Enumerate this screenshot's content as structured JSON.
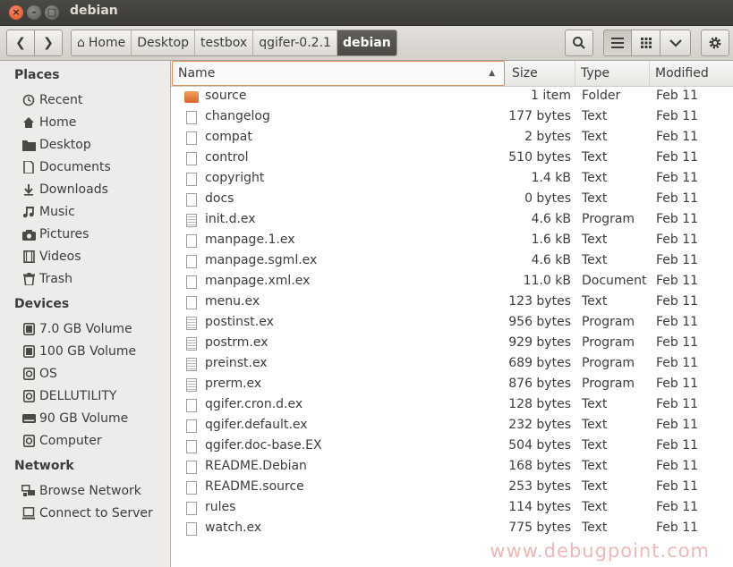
{
  "window": {
    "title": "debian"
  },
  "toolbar": {
    "breadcrumbs": [
      "Home",
      "Desktop",
      "testbox",
      "qgifer-0.2.1",
      "debian"
    ]
  },
  "sidebar": {
    "places_heading": "Places",
    "places": [
      {
        "label": "Recent",
        "icon": "clock-icon"
      },
      {
        "label": "Home",
        "icon": "home-icon"
      },
      {
        "label": "Desktop",
        "icon": "folder-icon"
      },
      {
        "label": "Documents",
        "icon": "document-icon"
      },
      {
        "label": "Downloads",
        "icon": "download-icon"
      },
      {
        "label": "Music",
        "icon": "music-icon"
      },
      {
        "label": "Pictures",
        "icon": "camera-icon"
      },
      {
        "label": "Videos",
        "icon": "film-icon"
      },
      {
        "label": "Trash",
        "icon": "trash-icon"
      }
    ],
    "devices_heading": "Devices",
    "devices": [
      {
        "label": "7.0 GB Volume",
        "icon": "drive-icon"
      },
      {
        "label": "100 GB Volume",
        "icon": "drive-icon"
      },
      {
        "label": "OS",
        "icon": "drive-icon"
      },
      {
        "label": "DELLUTILITY",
        "icon": "drive-icon"
      },
      {
        "label": "90 GB Volume",
        "icon": "drive-icon"
      },
      {
        "label": "Computer",
        "icon": "computer-icon"
      }
    ],
    "network_heading": "Network",
    "network": [
      {
        "label": "Browse Network",
        "icon": "network-icon"
      },
      {
        "label": "Connect to Server",
        "icon": "server-icon"
      }
    ]
  },
  "columns": {
    "name": "Name",
    "size": "Size",
    "type": "Type",
    "modified": "Modified"
  },
  "files": [
    {
      "name": "source",
      "size": "1 item",
      "type": "Folder",
      "modified": "Feb 11",
      "kind": "folder"
    },
    {
      "name": "changelog",
      "size": "177 bytes",
      "type": "Text",
      "modified": "Feb 11",
      "kind": "text"
    },
    {
      "name": "compat",
      "size": "2 bytes",
      "type": "Text",
      "modified": "Feb 11",
      "kind": "text"
    },
    {
      "name": "control",
      "size": "510 bytes",
      "type": "Text",
      "modified": "Feb 11",
      "kind": "text"
    },
    {
      "name": "copyright",
      "size": "1.4 kB",
      "type": "Text",
      "modified": "Feb 11",
      "kind": "text"
    },
    {
      "name": "docs",
      "size": "0 bytes",
      "type": "Text",
      "modified": "Feb 11",
      "kind": "text"
    },
    {
      "name": "init.d.ex",
      "size": "4.6 kB",
      "type": "Program",
      "modified": "Feb 11",
      "kind": "program"
    },
    {
      "name": "manpage.1.ex",
      "size": "1.6 kB",
      "type": "Text",
      "modified": "Feb 11",
      "kind": "text"
    },
    {
      "name": "manpage.sgml.ex",
      "size": "4.6 kB",
      "type": "Text",
      "modified": "Feb 11",
      "kind": "text"
    },
    {
      "name": "manpage.xml.ex",
      "size": "11.0 kB",
      "type": "Document",
      "modified": "Feb 11",
      "kind": "text"
    },
    {
      "name": "menu.ex",
      "size": "123 bytes",
      "type": "Text",
      "modified": "Feb 11",
      "kind": "text"
    },
    {
      "name": "postinst.ex",
      "size": "956 bytes",
      "type": "Program",
      "modified": "Feb 11",
      "kind": "program"
    },
    {
      "name": "postrm.ex",
      "size": "929 bytes",
      "type": "Program",
      "modified": "Feb 11",
      "kind": "program"
    },
    {
      "name": "preinst.ex",
      "size": "689 bytes",
      "type": "Program",
      "modified": "Feb 11",
      "kind": "program"
    },
    {
      "name": "prerm.ex",
      "size": "876 bytes",
      "type": "Program",
      "modified": "Feb 11",
      "kind": "program"
    },
    {
      "name": "qgifer.cron.d.ex",
      "size": "128 bytes",
      "type": "Text",
      "modified": "Feb 11",
      "kind": "text"
    },
    {
      "name": "qgifer.default.ex",
      "size": "232 bytes",
      "type": "Text",
      "modified": "Feb 11",
      "kind": "text"
    },
    {
      "name": "qgifer.doc-base.EX",
      "size": "504 bytes",
      "type": "Text",
      "modified": "Feb 11",
      "kind": "text"
    },
    {
      "name": "README.Debian",
      "size": "168 bytes",
      "type": "Text",
      "modified": "Feb 11",
      "kind": "text"
    },
    {
      "name": "README.source",
      "size": "253 bytes",
      "type": "Text",
      "modified": "Feb 11",
      "kind": "text"
    },
    {
      "name": "rules",
      "size": "114 bytes",
      "type": "Text",
      "modified": "Feb 11",
      "kind": "text"
    },
    {
      "name": "watch.ex",
      "size": "775 bytes",
      "type": "Text",
      "modified": "Feb 11",
      "kind": "text"
    }
  ],
  "watermark": "www.debugpoint.com",
  "colors": {
    "accent": "#e2531d",
    "titlebar": "#3c3b37",
    "folder": "#e07a3a"
  }
}
